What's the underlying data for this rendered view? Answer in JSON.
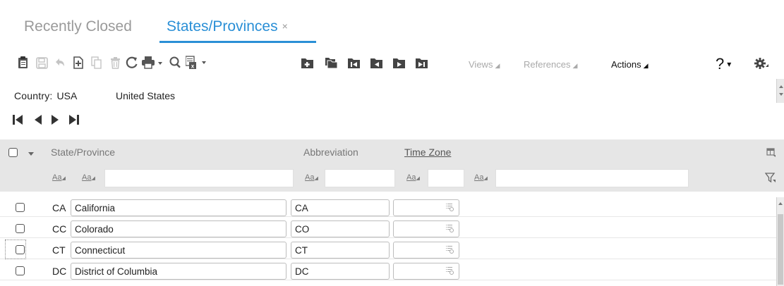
{
  "tabs": {
    "recent_label": "Recently Closed",
    "active_label": "States/Provinces",
    "close_glyph": "×"
  },
  "toolbar": {
    "icons": [
      "paste-icon",
      "save-icon",
      "undo-icon",
      "new-record-icon",
      "copy-icon",
      "delete-icon",
      "refresh-icon",
      "print-icon",
      "search-icon",
      "export-icon",
      "folder-1-icon",
      "folder-2-icon",
      "folder-3-icon",
      "folder-4-icon",
      "folder-5-icon",
      "folder-6-icon"
    ],
    "menus": {
      "views": "Views",
      "references": "References",
      "actions": "Actions"
    },
    "help_glyph": "?",
    "caret_glyph": "▾",
    "menu_tri": "◢"
  },
  "country": {
    "label": "Country:",
    "code": "USA",
    "name": "United States"
  },
  "grid": {
    "headers": {
      "state": "State/Province",
      "abbreviation": "Abbreviation",
      "timezone": "Time Zone"
    },
    "aa_label": "Aa",
    "rows": [
      {
        "code": "CA",
        "name": "California",
        "abbr": "CA"
      },
      {
        "code": "CC",
        "name": "Colorado",
        "abbr": "CO"
      },
      {
        "code": "CT",
        "name": "Connecticut",
        "abbr": "CT"
      },
      {
        "code": "DC",
        "name": "District of Columbia",
        "abbr": "DC"
      }
    ]
  },
  "colors": {
    "accent": "#2a8fd6",
    "header_bg": "#e6e6e6",
    "muted": "#9a9a9a"
  }
}
